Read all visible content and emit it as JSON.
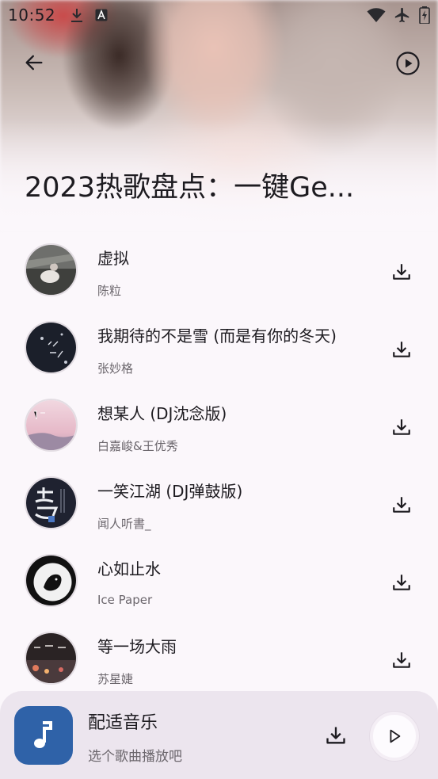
{
  "status_bar": {
    "time": "10:52",
    "left_icons": [
      "download-icon",
      "text-a-icon"
    ],
    "right_icons": [
      "wifi-icon",
      "airplane-icon",
      "battery-charging-icon"
    ]
  },
  "header": {
    "back_icon": "arrow-back-icon",
    "play_icon": "play-circle-icon",
    "title": "2023热歌盘点：一键Ge..."
  },
  "songs": [
    {
      "title": "虚拟",
      "artist": "陈粒"
    },
    {
      "title": "我期待的不是雪 (而是有你的冬天)",
      "artist": "张妙格"
    },
    {
      "title": "想某人 (DJ沈念版)",
      "artist": "白嘉峻&王优秀"
    },
    {
      "title": "一笑江湖 (DJ弹鼓版)",
      "artist": "闻人听書_"
    },
    {
      "title": "心如止水",
      "artist": "Ice Paper"
    },
    {
      "title": "等一场大雨",
      "artist": "苏星婕"
    }
  ],
  "player": {
    "title": "配适音乐",
    "subtitle": "选个歌曲播放吧",
    "art_icon": "music-note-icon",
    "colors": {
      "art_bg": "#2f62a8",
      "bar_bg": "#ece5ee"
    }
  }
}
